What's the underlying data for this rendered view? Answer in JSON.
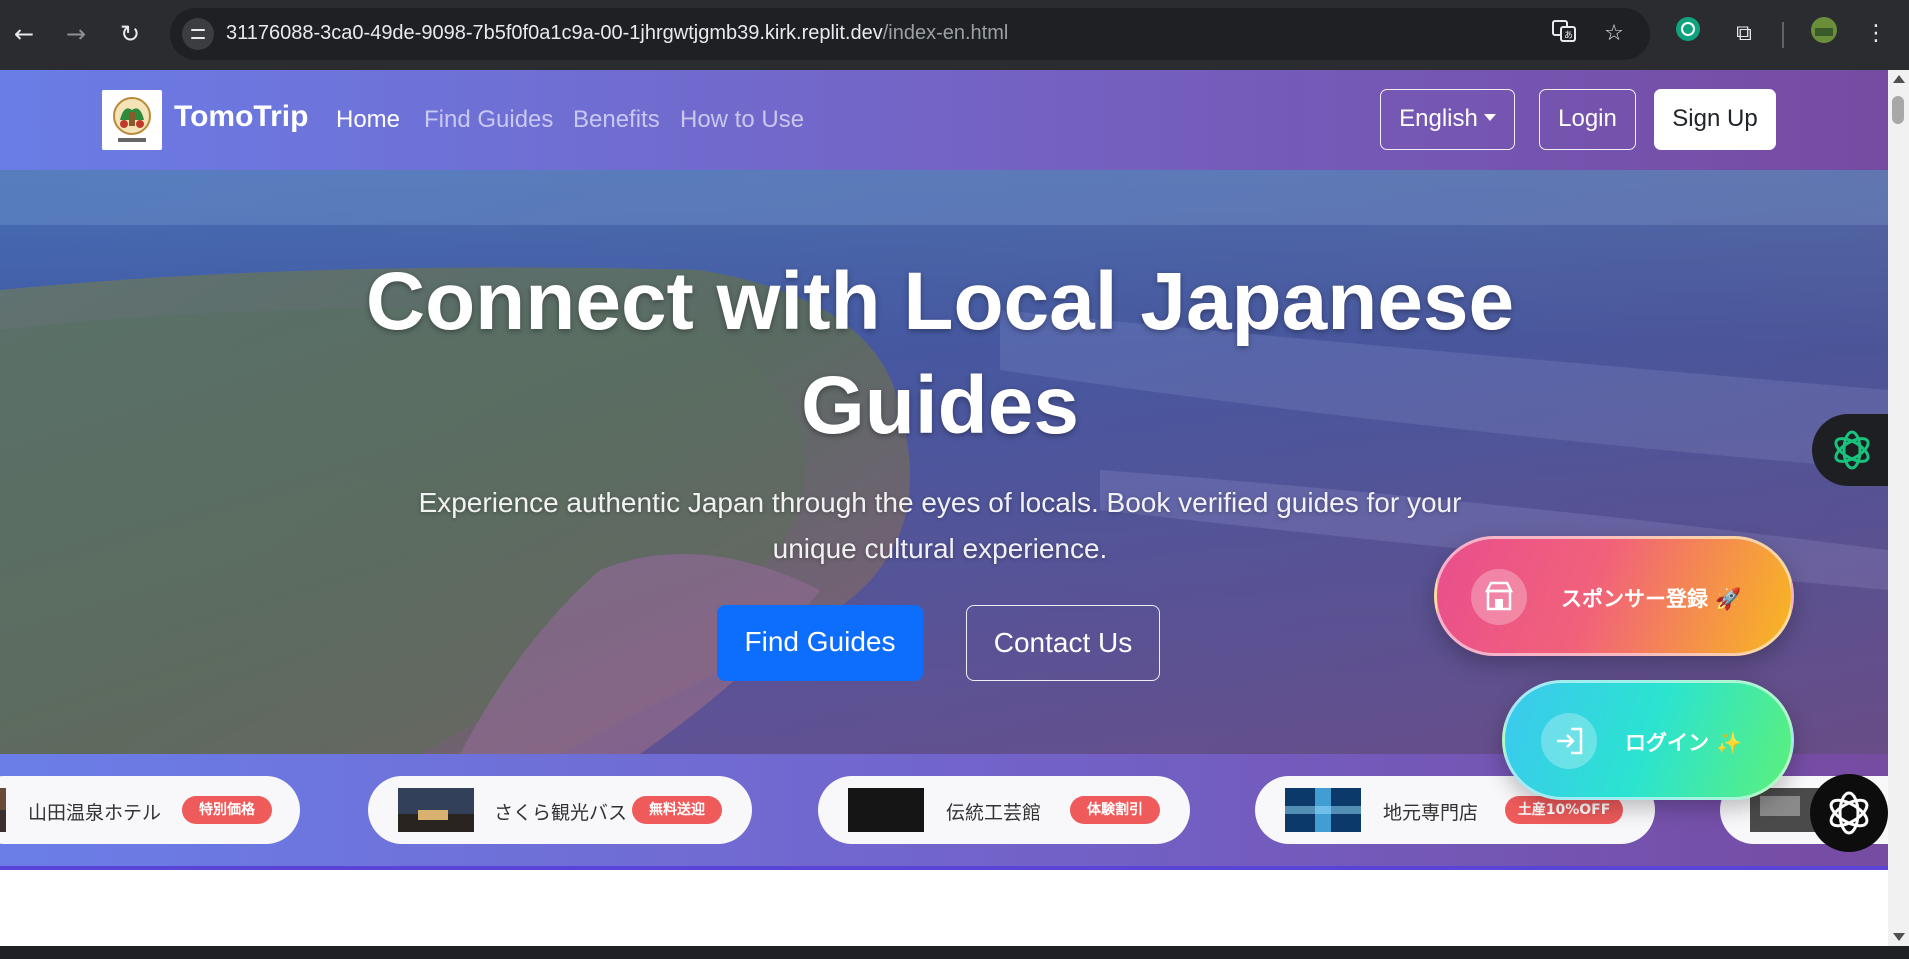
{
  "browser": {
    "url_main": "31176088-3ca0-49de-9098-7b5f0f0a1c9a-00-1jhrgwtjgmb39.kirk.replit.dev",
    "url_path": "/index-en.html",
    "back_icon": "←",
    "forward_icon": "→",
    "reload_icon": "↻",
    "star_icon": "☆",
    "menu_icon": "⋮",
    "extensions_icon": "⧉"
  },
  "navbar": {
    "brand": "TomoTrip",
    "links": [
      {
        "label": "Home",
        "active": true
      },
      {
        "label": "Find Guides",
        "active": false
      },
      {
        "label": "Benefits",
        "active": false
      },
      {
        "label": "How to Use",
        "active": false
      }
    ],
    "language": "English",
    "login": "Login",
    "signup": "Sign Up"
  },
  "hero": {
    "title": "Connect with Local Japanese Guides",
    "subtitle": "Experience authentic Japan through the eyes of locals. Book verified guides for your unique cultural experience.",
    "primary_button": "Find Guides",
    "secondary_button": "Contact Us"
  },
  "floating": {
    "sponsor_label": "スポンサー登録 🚀",
    "login_label": "ログイン ✨"
  },
  "sponsors": [
    {
      "name": "山田温泉ホテル",
      "badge": "特別価格"
    },
    {
      "name": "さくら観光バス",
      "badge": "無料送迎"
    },
    {
      "name": "伝統工芸館",
      "badge": "体験割引"
    },
    {
      "name": "地元専門店",
      "badge": "土産10%OFF"
    }
  ],
  "colors": {
    "nav_gradient_start": "#667eea",
    "nav_gradient_end": "#764ba2",
    "primary_button": "#0d6efd",
    "badge": "#ef5b5b"
  }
}
